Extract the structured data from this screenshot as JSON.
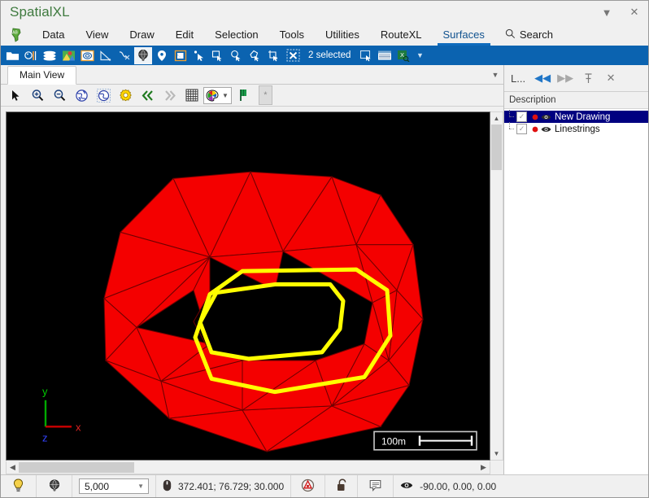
{
  "window": {
    "title": "SpatialXL",
    "title_color": "#3f7a3f",
    "dropdown_icon": "chevron-down-icon",
    "close_icon": "close-icon"
  },
  "menubar": {
    "logo_label": "AB",
    "items": [
      {
        "label": "Data",
        "active": false
      },
      {
        "label": "View",
        "active": false
      },
      {
        "label": "Draw",
        "active": false
      },
      {
        "label": "Edit",
        "active": false
      },
      {
        "label": "Selection",
        "active": false
      },
      {
        "label": "Tools",
        "active": false
      },
      {
        "label": "Utilities",
        "active": false
      },
      {
        "label": "RouteXL",
        "active": false
      },
      {
        "label": "Surfaces",
        "active": true
      }
    ],
    "search_label": "Search",
    "search_icon": "search-icon",
    "active_accent": "#0f6cbd"
  },
  "ribbon": {
    "background": "#0b63b0",
    "selection_status": "2 selected",
    "icons": [
      "open-folder-icon",
      "palette-tools-icon",
      "layers-stack-icon",
      "map-image-icon",
      "surface-contour-icon",
      "triangle-measure-icon",
      "spline-curve-icon",
      "globe-surface-icon",
      "map-pin-icon",
      "note-page-icon",
      "select-point-icon",
      "select-rectangle-icon",
      "select-circle-icon",
      "select-polygon-icon",
      "select-crop-icon",
      "clear-selection-icon"
    ],
    "trailing_icons": [
      "selection-window-icon",
      "table-report-icon",
      "excel-export-icon"
    ],
    "overflow_icon": "chevron-down-icon"
  },
  "document_tabs": {
    "tabs": [
      {
        "label": "Main View",
        "active": true
      }
    ],
    "overflow_icon": "chevron-down-icon"
  },
  "viewbar": {
    "icons": [
      "arrow-cursor-icon",
      "zoom-in-icon",
      "zoom-out-icon",
      "globe-rotate-icon",
      "globe-pan-icon",
      "gear-settings-icon",
      "rewind-fast-icon",
      "forward-fast-icon",
      "grid-icon",
      "color-palette-icon",
      "green-flag-icon"
    ],
    "palette_caret": "chevron-down-icon",
    "extra_button": "asterisk-icon"
  },
  "canvas": {
    "background": "#000000",
    "scale_bar_label": "100m",
    "axis": {
      "x_label": "x",
      "x_color": "#cc0000",
      "y_label": "y",
      "y_color": "#00aa00",
      "z_label": "z",
      "z_color": "#2222dd"
    },
    "surface": {
      "fill_color": "#f40000",
      "edge_color": "#7a0000",
      "linestring_color": "#ffff00",
      "description": "triangulated surface with hole and two yellow contour linestrings"
    }
  },
  "scrollbars": {
    "up_icon": "chevron-up-icon",
    "down_icon": "chevron-down-icon",
    "left_icon": "chevron-left-icon",
    "right_icon": "chevron-right-icon"
  },
  "layers_panel": {
    "title": "L...",
    "buttons": [
      "prev-icon",
      "next-icon",
      "pin-icon",
      "close-icon"
    ],
    "column_header": "Description",
    "rows": [
      {
        "label": "New Drawing",
        "checked": true,
        "selected": true,
        "visible": true
      },
      {
        "label": "Linestrings",
        "checked": true,
        "selected": false,
        "visible": true
      }
    ],
    "selected_color": "#000080"
  },
  "statusbar": {
    "bulb_icon": "lightbulb-icon",
    "globe_icon": "globe-wire-icon",
    "scale_value": "5,000",
    "scale_caret": "chevron-down-icon",
    "mouse_icon": "mouse-icon",
    "coordinates": "372.401; 76.729; 30.000",
    "snap_icon": "snap-target-icon",
    "lock_icon": "lock-open-icon",
    "annotation_icon": "comment-icon",
    "eye_icon": "eye-icon",
    "view_angles": "-90.00, 0.00, 0.00"
  }
}
